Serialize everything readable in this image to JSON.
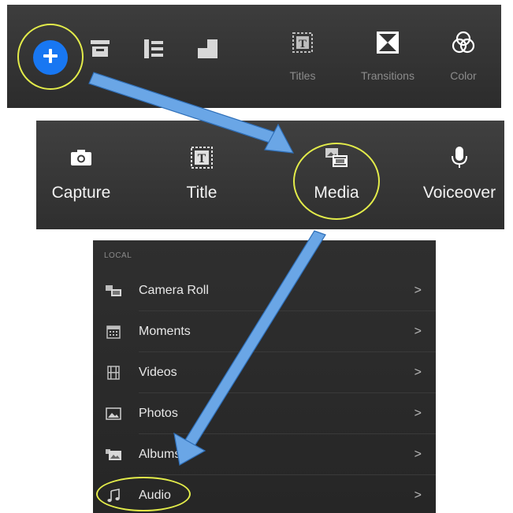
{
  "colors": {
    "accent_blue": "#1877f2",
    "highlight_yellow": "#e3ec4a",
    "arrow_blue": "#6aa6e6",
    "panel_dark": "#2f2f2f"
  },
  "toolbar": {
    "add_icon": "plus-circle-icon",
    "tools": [
      {
        "icon": "clip-icon",
        "label": ""
      },
      {
        "icon": "align-icon",
        "label": ""
      },
      {
        "icon": "layers-icon",
        "label": ""
      },
      {
        "icon": "titles-icon",
        "label": "Titles"
      },
      {
        "icon": "transitions-icon",
        "label": "Transitions"
      },
      {
        "icon": "color-icon",
        "label": "Color"
      }
    ]
  },
  "add_menu": {
    "items": [
      {
        "icon": "camera-icon",
        "label": "Capture"
      },
      {
        "icon": "title-icon",
        "label": "Title"
      },
      {
        "icon": "media-icon",
        "label": "Media"
      },
      {
        "icon": "microphone-icon",
        "label": "Voiceover"
      }
    ]
  },
  "local_list": {
    "section_header": "LOCAL",
    "items": [
      {
        "icon": "camera-roll-icon",
        "label": "Camera Roll",
        "chevron": ">"
      },
      {
        "icon": "calendar-icon",
        "label": "Moments",
        "chevron": ">"
      },
      {
        "icon": "film-icon",
        "label": "Videos",
        "chevron": ">"
      },
      {
        "icon": "photo-icon",
        "label": "Photos",
        "chevron": ">"
      },
      {
        "icon": "album-icon",
        "label": "Albums",
        "chevron": ">"
      },
      {
        "icon": "music-note-icon",
        "label": "Audio",
        "chevron": ">"
      }
    ]
  }
}
